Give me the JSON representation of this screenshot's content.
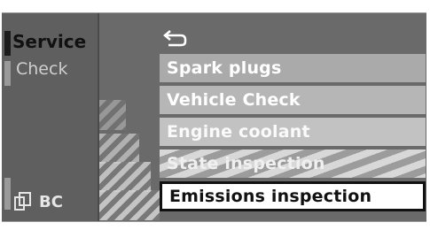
{
  "left_panel": {
    "title": "Service",
    "subtitle": "Check",
    "bottom_label": "BC"
  },
  "menu": {
    "back_icon": "back-arrow-icon",
    "items": [
      {
        "label": "Spark plugs"
      },
      {
        "label": "Vehicle Check"
      },
      {
        "label": "Engine coolant"
      },
      {
        "label": "State inspection"
      },
      {
        "label": "Emissions inspection",
        "selected": true
      }
    ]
  },
  "colors": {
    "background": "#5e5e5e",
    "selected_item_bg": "#ffffff",
    "selected_item_border": "#111111"
  }
}
